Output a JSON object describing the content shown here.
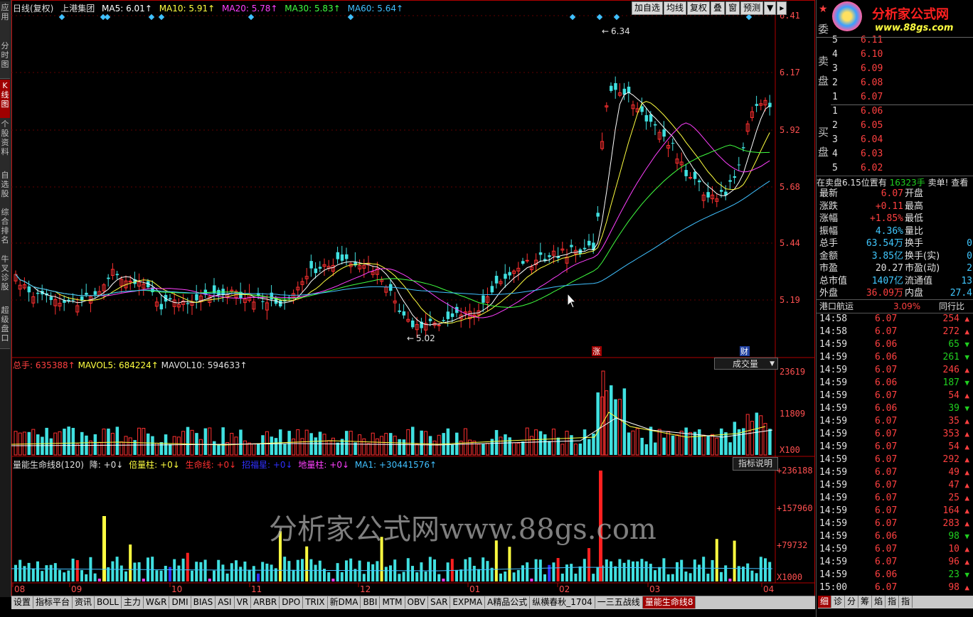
{
  "left_tabs": [
    {
      "label": "应用",
      "active": false
    },
    {
      "label": "分时图",
      "active": false
    },
    {
      "label": "K线图",
      "active": true
    },
    {
      "label": "个股资料",
      "active": false
    },
    {
      "label": "自选股",
      "active": false
    },
    {
      "label": "综合排名",
      "active": false
    },
    {
      "label": "牛叉诊股",
      "active": false
    },
    {
      "label": "超级盘口",
      "active": false
    }
  ],
  "header": {
    "period": "日线(复权)",
    "stock": "上港集团",
    "ma5": "MA5: 6.01↑",
    "ma10": "MA10: 5.91↑",
    "ma20": "MA20: 5.78↑",
    "ma30": "MA30: 5.83↑",
    "ma60": "MA60: 5.64↑",
    "buttons": [
      "加自选",
      "均线",
      "复权",
      "叠",
      "窗",
      "预测"
    ],
    "menu_arrow": "▼",
    "play_arrow": "▸"
  },
  "colors": {
    "ma5": "#ffffff",
    "ma10": "#ffff40",
    "ma20": "#ff40ff",
    "ma30": "#40ff40",
    "ma60": "#40c0ff",
    "up": "#ff3030",
    "down": "#40e0e0"
  },
  "price_axis": {
    "labels": [
      "6.41",
      "6.17",
      "5.92",
      "5.68",
      "5.44",
      "5.19"
    ]
  },
  "annotations": {
    "high": "6.34",
    "low": "5.02",
    "zhang": "涨",
    "cai": "财"
  },
  "volume": {
    "label_total": "总手: 635388↑",
    "label_mavol5": "MAVOL5: 684224↑",
    "label_mavol10": "MAVOL10: 594633↑",
    "selector": "成交量",
    "axis": [
      "23619",
      "11809",
      "X100"
    ]
  },
  "indicator": {
    "title": "量能生命线8(120)",
    "parts": [
      {
        "text": "降: +0↓",
        "color": "#e0e0e0"
      },
      {
        "text": "倍量柱: +0↓",
        "color": "#ffff40"
      },
      {
        "text": "生命线: +0↓",
        "color": "#ff3030"
      },
      {
        "text": "招福星: +0↓",
        "color": "#3030ff"
      },
      {
        "text": "地量柱: +0↓",
        "color": "#ff40ff"
      },
      {
        "text": "MA1: +30441576↑",
        "color": "#40c0ff"
      }
    ],
    "button": "指标说明",
    "axis": [
      "+236188",
      "+157960",
      "+79732",
      "X1000"
    ]
  },
  "watermark": "分析家公式网www.88gs.com",
  "months": [
    "08",
    "09",
    "10",
    "11",
    "12",
    "01",
    "02",
    "03",
    "04"
  ],
  "bottom_tabs": [
    "设置",
    "指标平台",
    "资讯",
    "BOLL",
    "主力",
    "W&R",
    "DMI",
    "BIAS",
    "ASI",
    "VR",
    "ARBR",
    "DPO",
    "TRIX",
    "新DMA",
    "BBI",
    "MTM",
    "OBV",
    "SAR",
    "EXPMA",
    "A精品公式",
    "纵横春秋_1704",
    "一三五战线",
    "量能生命线8"
  ],
  "bottom_active": "量能生命线8",
  "right": {
    "logo": "分析家公式网",
    "logo_url": "www.88gs.com",
    "wei": "委",
    "sell_label": "卖盘",
    "buy_label": "买盘",
    "sells": [
      {
        "lvl": "5",
        "price": "6.11"
      },
      {
        "lvl": "4",
        "price": "6.10"
      },
      {
        "lvl": "3",
        "price": "6.09"
      },
      {
        "lvl": "2",
        "price": "6.08"
      },
      {
        "lvl": "1",
        "price": "6.07"
      }
    ],
    "buys": [
      {
        "lvl": "1",
        "price": "6.06"
      },
      {
        "lvl": "2",
        "price": "6.05"
      },
      {
        "lvl": "3",
        "price": "6.04"
      },
      {
        "lvl": "4",
        "price": "6.03"
      },
      {
        "lvl": "5",
        "price": "6.02"
      }
    ],
    "notice": "在卖盘6.15位置有",
    "notice_qty": "16323手",
    "notice_tail": "卖单! 查看",
    "stats": [
      {
        "k": "最新",
        "v": "6.07",
        "vc": "red",
        "k2": "开盘",
        "v2": ""
      },
      {
        "k": "涨跌",
        "v": "+0.11",
        "vc": "red",
        "k2": "最高",
        "v2": ""
      },
      {
        "k": "涨幅",
        "v": "+1.85%",
        "vc": "red",
        "k2": "最低",
        "v2": ""
      },
      {
        "k": "振幅",
        "v": "4.36%",
        "vc": "cy",
        "k2": "量比",
        "v2": ""
      },
      {
        "k": "总手",
        "v": "63.54万",
        "vc": "cy",
        "k2": "换手",
        "v2": "0"
      },
      {
        "k": "金额",
        "v": "3.85亿",
        "vc": "cy",
        "k2": "换手(实)",
        "v2": "0"
      },
      {
        "k": "市盈",
        "v": "20.27",
        "vc": "wh",
        "k2": "市盈(动)",
        "v2": "2"
      },
      {
        "k": "总市值",
        "v": "1407亿",
        "vc": "cy",
        "k2": "流通值",
        "v2": "13"
      },
      {
        "k": "外盘",
        "v": "36.09万",
        "vc": "red",
        "k2": "内盘",
        "v2": "27.4"
      }
    ],
    "sector": "港口航运",
    "sector_pct": "3.09%",
    "sector_btn": "同行比",
    "ticks": [
      {
        "t": "14:58",
        "p": "6.07",
        "v": "254",
        "d": "up"
      },
      {
        "t": "14:58",
        "p": "6.07",
        "v": "272",
        "d": "up"
      },
      {
        "t": "14:59",
        "p": "6.06",
        "v": "65",
        "d": "down"
      },
      {
        "t": "14:59",
        "p": "6.06",
        "v": "261",
        "d": "down"
      },
      {
        "t": "14:59",
        "p": "6.07",
        "v": "246",
        "d": "up"
      },
      {
        "t": "14:59",
        "p": "6.06",
        "v": "187",
        "d": "down"
      },
      {
        "t": "14:59",
        "p": "6.07",
        "v": "54",
        "d": "up"
      },
      {
        "t": "14:59",
        "p": "6.06",
        "v": "39",
        "d": "down"
      },
      {
        "t": "14:59",
        "p": "6.07",
        "v": "35",
        "d": "up"
      },
      {
        "t": "14:59",
        "p": "6.07",
        "v": "353",
        "d": "up"
      },
      {
        "t": "14:59",
        "p": "6.07",
        "v": "54",
        "d": "up"
      },
      {
        "t": "14:59",
        "p": "6.07",
        "v": "292",
        "d": "up"
      },
      {
        "t": "14:59",
        "p": "6.07",
        "v": "49",
        "d": "up"
      },
      {
        "t": "14:59",
        "p": "6.07",
        "v": "47",
        "d": "up"
      },
      {
        "t": "14:59",
        "p": "6.07",
        "v": "25",
        "d": "up"
      },
      {
        "t": "14:59",
        "p": "6.07",
        "v": "164",
        "d": "up"
      },
      {
        "t": "14:59",
        "p": "6.07",
        "v": "283",
        "d": "up"
      },
      {
        "t": "14:59",
        "p": "6.06",
        "v": "98",
        "d": "down"
      },
      {
        "t": "14:59",
        "p": "6.07",
        "v": "10",
        "d": "up"
      },
      {
        "t": "14:59",
        "p": "6.07",
        "v": "96",
        "d": "up"
      },
      {
        "t": "14:59",
        "p": "6.06",
        "v": "23",
        "d": "down"
      },
      {
        "t": "15:00",
        "p": "6.07",
        "v": "98",
        "d": "up"
      }
    ],
    "bottom_tabs": [
      "细",
      "诊",
      "分",
      "筹",
      "焰",
      "指",
      "指"
    ]
  }
}
